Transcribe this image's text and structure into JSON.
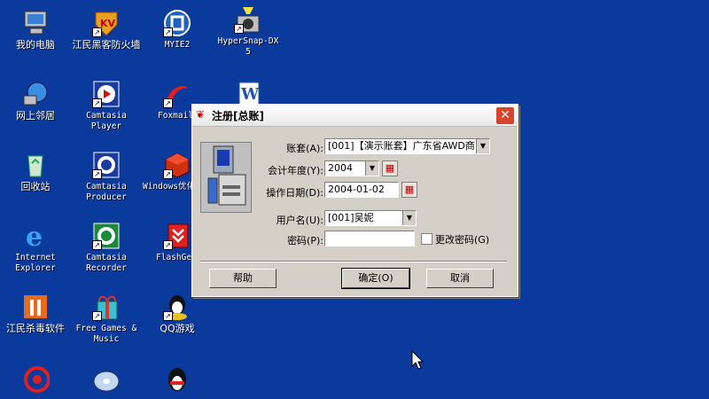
{
  "desktop": {
    "icons": [
      {
        "label": "我的电脑",
        "icon": "my-computer-icon"
      },
      {
        "label": "江民黑客防火墙",
        "icon": "firewall-icon"
      },
      {
        "label": "MYIE2",
        "icon": "myie2-icon"
      },
      {
        "label": "HyperSnap-DX 5",
        "icon": "hypersnap-icon"
      },
      {
        "label": "网上邻居",
        "icon": "network-places-icon"
      },
      {
        "label": "Camtasia Player",
        "icon": "camtasia-player-icon"
      },
      {
        "label": "Foxmail",
        "icon": "foxmail-icon"
      },
      {
        "label": "",
        "icon": "word-icon"
      },
      {
        "label": "回收站",
        "icon": "recycle-bin-icon"
      },
      {
        "label": "Camtasia Producer",
        "icon": "camtasia-producer-icon"
      },
      {
        "label": "Windows优化大师",
        "icon": "windows-optimizer-icon"
      },
      {
        "label": "Internet Explorer",
        "icon": "internet-explorer-icon"
      },
      {
        "label": "Camtasia Recorder",
        "icon": "camtasia-recorder-icon"
      },
      {
        "label": "FlashGet",
        "icon": "flashget-icon"
      },
      {
        "label": "江民杀毒软件",
        "icon": "antivirus-icon"
      },
      {
        "label": "Free Games & Music",
        "icon": "free-games-icon"
      },
      {
        "label": "QQ游戏",
        "icon": "qq-game-icon"
      }
    ]
  },
  "dialog": {
    "title": "注册[总账]",
    "account_label": "账套(A):",
    "account_value": "[001]【演示账套】广东省AWD商",
    "year_label": "会计年度(Y):",
    "year_value": "2004",
    "date_label": "操作日期(D):",
    "date_value": "2004-01-02",
    "user_label": "用户名(U):",
    "user_value": "[001]吴妮",
    "password_label": "密码(P):",
    "password_value": "",
    "change_password_label": "更改密码(G)",
    "help_label": "帮助",
    "ok_label": "确定(O)",
    "cancel_label": "取消",
    "close_glyph": "✕"
  },
  "colors": {
    "desktop_bg": "#0a3a9c",
    "dialog_bg": "#d4d0c8",
    "close_btn": "#d9432b"
  }
}
